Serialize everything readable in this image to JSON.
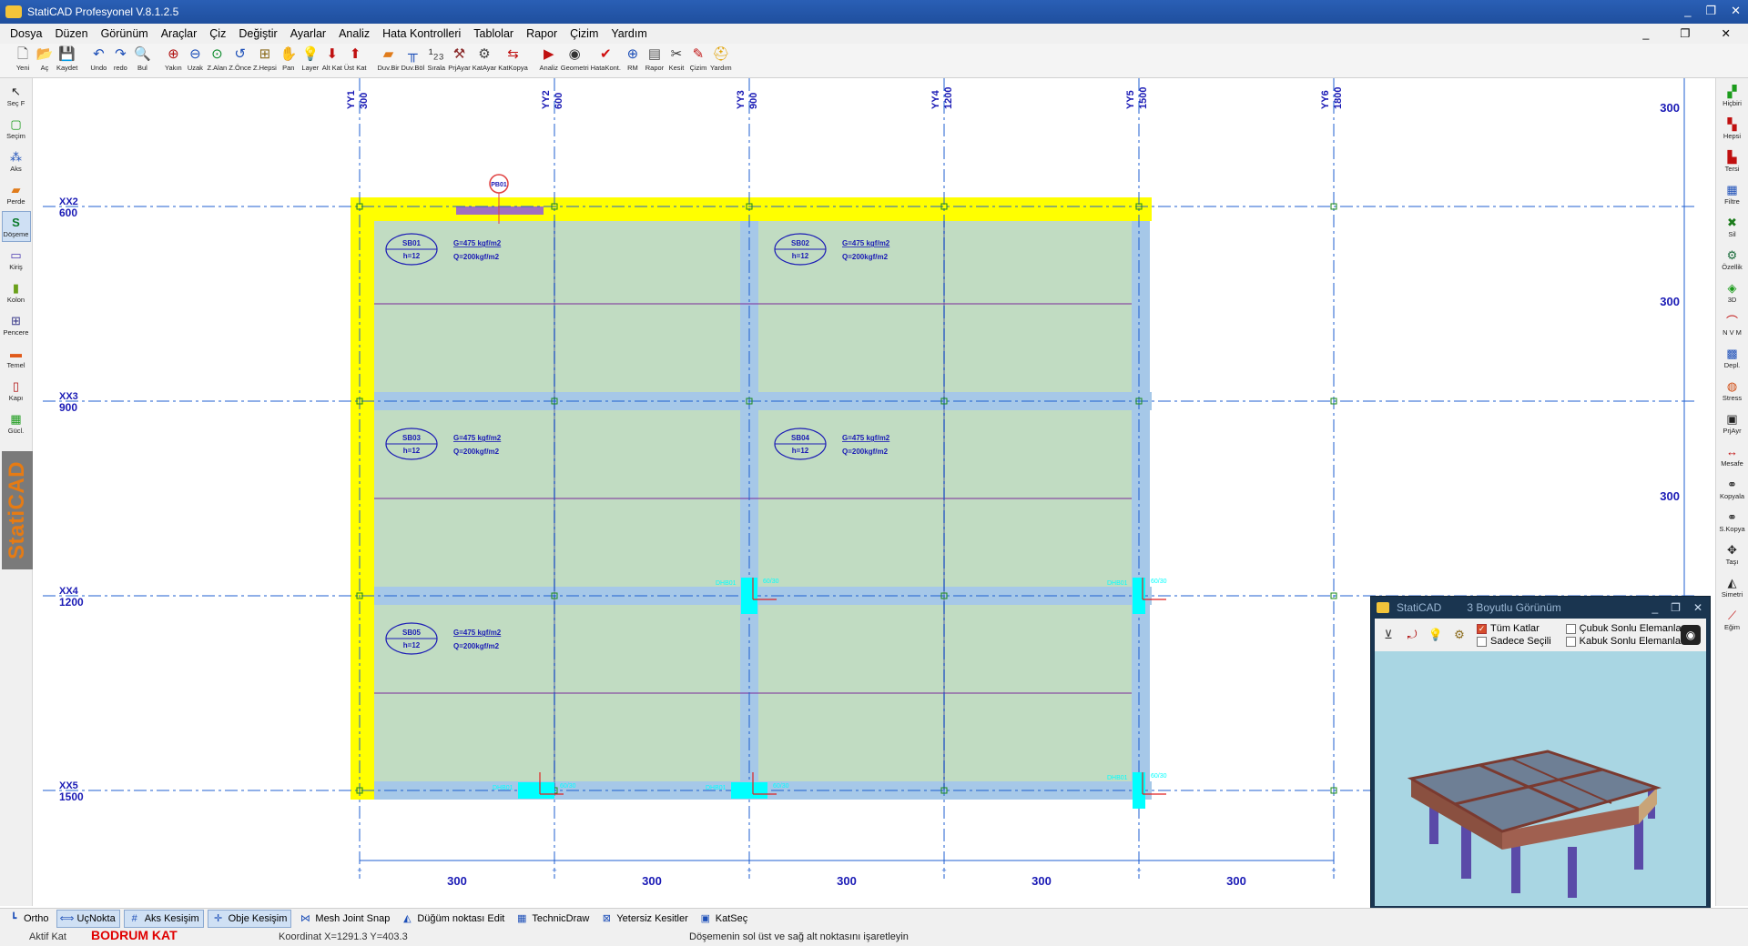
{
  "window": {
    "title": "StatiCAD Profesyonel V.8.1.2.5",
    "controls": [
      "_",
      "❐",
      "✕"
    ]
  },
  "menu": {
    "items": [
      "Dosya",
      "Düzen",
      "Görünüm",
      "Araçlar",
      "Çiz",
      "Değiştir",
      "Ayarlar",
      "Analiz",
      "Hata Kontrolleri",
      "Tablolar",
      "Rapor",
      "Çizim",
      "Yardım"
    ],
    "right_controls": [
      "_",
      "❐",
      "✕"
    ]
  },
  "toolbar": {
    "buttons": [
      {
        "label": "Yeni",
        "icon": "new-file-icon",
        "glyph": "🗋",
        "color": "#555"
      },
      {
        "label": "Aç",
        "icon": "open-folder-icon",
        "glyph": "📂",
        "color": "#c9a23a"
      },
      {
        "label": "Kaydet",
        "icon": "save-disk-icon",
        "glyph": "💾",
        "color": "#333"
      },
      {
        "label": "",
        "sep": true
      },
      {
        "label": "Undo",
        "icon": "undo-icon",
        "glyph": "↶",
        "color": "#1d4fb8"
      },
      {
        "label": "redo",
        "icon": "redo-icon",
        "glyph": "↷",
        "color": "#1d4fb8"
      },
      {
        "label": "Bul",
        "icon": "find-icon",
        "glyph": "🔍",
        "color": "#333"
      },
      {
        "label": "",
        "sep": true
      },
      {
        "label": "Yakın",
        "icon": "zoom-in-icon",
        "glyph": "⊕",
        "color": "#b01010"
      },
      {
        "label": "Uzak",
        "icon": "zoom-out-icon",
        "glyph": "⊖",
        "color": "#1d4fb8"
      },
      {
        "label": "Z.Alan",
        "icon": "zoom-area-icon",
        "glyph": "⊙",
        "color": "#0a8a2a"
      },
      {
        "label": "Z.Önce",
        "icon": "zoom-previous-icon",
        "glyph": "↺",
        "color": "#1d4fb8"
      },
      {
        "label": "Z.Hepsi",
        "icon": "zoom-all-icon",
        "glyph": "⊞",
        "color": "#8a6a1a"
      },
      {
        "label": "Pan",
        "icon": "pan-hand-icon",
        "glyph": "✋",
        "color": "#b9892a"
      },
      {
        "label": "Layer",
        "icon": "layer-bulb-icon",
        "glyph": "💡",
        "color": "#e0b000"
      },
      {
        "label": "Alt Kat",
        "icon": "lower-floor-icon",
        "glyph": "⬇",
        "color": "#c01010"
      },
      {
        "label": "Üst Kat",
        "icon": "upper-floor-icon",
        "glyph": "⬆",
        "color": "#c01010"
      },
      {
        "label": "",
        "sep": true
      },
      {
        "label": "Duv.Bir",
        "icon": "wall-join-icon",
        "glyph": "▰",
        "color": "#e07b1a"
      },
      {
        "label": "Duv.Böl",
        "icon": "wall-split-icon",
        "glyph": "╥",
        "color": "#1d4fb8"
      },
      {
        "label": "Sırala",
        "icon": "sort-numbers-icon",
        "glyph": "¹₂₃",
        "color": "#333"
      },
      {
        "label": "PrjAyar",
        "icon": "project-settings-icon",
        "glyph": "⚒",
        "color": "#8a2a2a"
      },
      {
        "label": "KatAyar",
        "icon": "floor-settings-icon",
        "glyph": "⚙",
        "color": "#444"
      },
      {
        "label": "KatKopya",
        "icon": "floor-copy-icon",
        "glyph": "⇆",
        "color": "#c01010"
      },
      {
        "label": "",
        "sep": true
      },
      {
        "label": "Analiz",
        "icon": "analysis-icon",
        "glyph": "▶",
        "color": "#c01010"
      },
      {
        "label": "Geometri",
        "icon": "geometry-icon",
        "glyph": "◉",
        "color": "#333"
      },
      {
        "label": "HataKont.",
        "icon": "error-check-icon",
        "glyph": "✔",
        "color": "#d01010"
      },
      {
        "label": "RM",
        "icon": "rm-target-icon",
        "glyph": "⊕",
        "color": "#1d4fb8"
      },
      {
        "label": "Rapor",
        "icon": "report-icon",
        "glyph": "▤",
        "color": "#555"
      },
      {
        "label": "Kesit",
        "icon": "section-icon",
        "glyph": "✂",
        "color": "#333"
      },
      {
        "label": "Çizim",
        "icon": "drawing-icon",
        "glyph": "✎",
        "color": "#c01010"
      },
      {
        "label": "Yardım",
        "icon": "help-icon",
        "glyph": "⛑",
        "color": "#e0a000"
      }
    ]
  },
  "left_tools": [
    {
      "label": "Seç F",
      "icon": "select-cursor-icon",
      "glyph": "↖",
      "color": "#222"
    },
    {
      "label": "Seçim",
      "icon": "selection-box-icon",
      "glyph": "▢",
      "color": "#1b9b1b"
    },
    {
      "label": "Aks",
      "icon": "axis-icon",
      "glyph": "⁂",
      "color": "#1d4fb8"
    },
    {
      "label": "Perde",
      "icon": "shear-wall-icon",
      "glyph": "▰",
      "color": "#e07b1a"
    },
    {
      "label": "Döşeme",
      "icon": "slab-icon",
      "glyph": "S",
      "color": "#0a7a2a",
      "active": true
    },
    {
      "label": "Kiriş",
      "icon": "beam-icon",
      "glyph": "▭",
      "color": "#4a3ab0"
    },
    {
      "label": "Kolon",
      "icon": "column-icon",
      "glyph": "▮",
      "color": "#6aa01a"
    },
    {
      "label": "Pencere",
      "icon": "window-icon",
      "glyph": "⊞",
      "color": "#3a3a8a"
    },
    {
      "label": "Temel",
      "icon": "foundation-icon",
      "glyph": "▬",
      "color": "#e05a1a"
    },
    {
      "label": "Kapı",
      "icon": "door-icon",
      "glyph": "▯",
      "color": "#b01010"
    },
    {
      "label": "Gücl.",
      "icon": "strengthen-icon",
      "glyph": "▦",
      "color": "#1b9b1b"
    }
  ],
  "brand": "StatiCAD",
  "right_tools": [
    {
      "label": "Hiçbiri",
      "icon": "select-none-icon",
      "glyph": "▞",
      "color": "#1b9b1b"
    },
    {
      "label": "Hepsi",
      "icon": "select-all-icon",
      "glyph": "▚",
      "color": "#c01010"
    },
    {
      "label": "Tersi",
      "icon": "select-invert-icon",
      "glyph": "▙",
      "color": "#c01010"
    },
    {
      "label": "Filtre",
      "icon": "filter-icon",
      "glyph": "▦",
      "color": "#1d4fb8"
    },
    {
      "label": "Sil",
      "icon": "delete-icon",
      "glyph": "✖",
      "color": "#1b7b1b"
    },
    {
      "label": "Özellik",
      "icon": "properties-icon",
      "glyph": "⚙",
      "color": "#1b6b3b"
    },
    {
      "label": "3D",
      "icon": "3d-view-icon",
      "glyph": "◈",
      "color": "#1b9b1b"
    },
    {
      "label": "N V M",
      "icon": "nvm-diagram-icon",
      "glyph": "⌒",
      "color": "#c01010"
    },
    {
      "label": "Depl.",
      "icon": "displacement-icon",
      "glyph": "▩",
      "color": "#1d4fb8"
    },
    {
      "label": "Stress",
      "icon": "stress-icon",
      "glyph": "◍",
      "color": "#d04a10"
    },
    {
      "label": "PrjAyr",
      "icon": "project-adjust-icon",
      "glyph": "▣",
      "color": "#222"
    },
    {
      "label": "Mesafe",
      "icon": "distance-icon",
      "glyph": "↔",
      "color": "#c01010"
    },
    {
      "label": "Kopyala",
      "icon": "copy-icon",
      "glyph": "⚭",
      "color": "#222"
    },
    {
      "label": "S.Kopya",
      "icon": "special-copy-icon",
      "glyph": "⚭",
      "color": "#222"
    },
    {
      "label": "Taşı",
      "icon": "move-icon",
      "glyph": "✥",
      "color": "#222"
    },
    {
      "label": "Simetri",
      "icon": "mirror-icon",
      "glyph": "◭",
      "color": "#222"
    },
    {
      "label": "Eğim",
      "icon": "slope-icon",
      "glyph": "⟋",
      "color": "#c01010"
    }
  ],
  "drawing": {
    "vertical_axes": [
      {
        "name": "YY1",
        "coord": "300"
      },
      {
        "name": "YY2",
        "coord": "600"
      },
      {
        "name": "YY3",
        "coord": "900"
      },
      {
        "name": "YY4",
        "coord": "1200"
      },
      {
        "name": "YY5",
        "coord": "1500"
      },
      {
        "name": "YY6",
        "coord": "1800"
      }
    ],
    "horizontal_axes": [
      {
        "name": "XX2",
        "coord": "600"
      },
      {
        "name": "XX3",
        "coord": "900"
      },
      {
        "name": "XX4",
        "coord": "1200"
      },
      {
        "name": "XX5",
        "coord": "1500"
      }
    ],
    "bottom_dimensions": [
      "300",
      "300",
      "300",
      "300",
      "300"
    ],
    "right_dimensions": [
      "300",
      "300",
      "300"
    ],
    "slabs": [
      {
        "name": "SB01",
        "h": "h=12",
        "g": "G=475 kgf/m2",
        "q": "Q=200kgf/m2"
      },
      {
        "name": "SB02",
        "h": "h=12",
        "g": "G=475 kgf/m2",
        "q": "Q=200kgf/m2"
      },
      {
        "name": "SB03",
        "h": "h=12",
        "g": "G=475 kgf/m2",
        "q": "Q=200kgf/m2"
      },
      {
        "name": "SB04",
        "h": "h=12",
        "g": "G=475 kgf/m2",
        "q": "Q=200kgf/m2"
      },
      {
        "name": "SB05",
        "h": "h=12",
        "g": "G=475 kgf/m2",
        "q": "Q=200kgf/m2"
      }
    ],
    "marker": "PB01",
    "column_labels": [
      "DHB01",
      "DHB01",
      "DHB01",
      "DHB01",
      "DHB01"
    ],
    "column_size": "60/30",
    "colors": {
      "slab_fill": "#c1dcc2",
      "beam": "#a6c8e8",
      "shear_wall": "#ffff00",
      "axis": "#1f5fd0",
      "axis_text": "#1a1ab5",
      "column": "#00ffff",
      "purple_line": "#7a2a9a"
    }
  },
  "view3d": {
    "title": "StatiCAD",
    "subtitle": "3 Boyutlu Görünüm",
    "checks": [
      {
        "label": "Tüm Katlar",
        "checked": true
      },
      {
        "label": "Sadece Seçili",
        "checked": false
      },
      {
        "label": "Çubuk Sonlu Elemanlar",
        "checked": false
      },
      {
        "label": "Kabuk Sonlu Elemanlar",
        "checked": false
      }
    ],
    "controls": [
      "_",
      "❐",
      "✕"
    ]
  },
  "snapbar": [
    {
      "label": "Ortho",
      "icon": "ortho-icon",
      "glyph": "┗",
      "on": false
    },
    {
      "label": "UçNokta",
      "icon": "endpoint-icon",
      "glyph": "⟺",
      "on": true
    },
    {
      "label": "Aks Kesişim",
      "icon": "axis-intersection-icon",
      "glyph": "#",
      "on": true
    },
    {
      "label": "Obje Kesişim",
      "icon": "object-intersection-icon",
      "glyph": "✛",
      "on": true
    },
    {
      "label": "Mesh Joint Snap",
      "icon": "mesh-joint-icon",
      "glyph": "⋈",
      "on": false
    },
    {
      "label": "Düğüm noktası Edit",
      "icon": "node-edit-icon",
      "glyph": "◭",
      "on": false
    },
    {
      "label": "TechnicDraw",
      "icon": "technic-draw-icon",
      "glyph": "▦",
      "on": false
    },
    {
      "label": "Yetersiz Kesitler",
      "icon": "insufficient-section-icon",
      "glyph": "⊠",
      "on": false
    },
    {
      "label": "KatSeç",
      "icon": "floor-select-icon",
      "glyph": "▣",
      "on": false
    }
  ],
  "status": {
    "aktif_label": "Aktif Kat",
    "kat": "BODRUM KAT",
    "koordinat": "Koordinat   X=1291.3   Y=403.3",
    "message": "Döşemenin sol üst ve sağ alt noktasını işaretleyin"
  }
}
